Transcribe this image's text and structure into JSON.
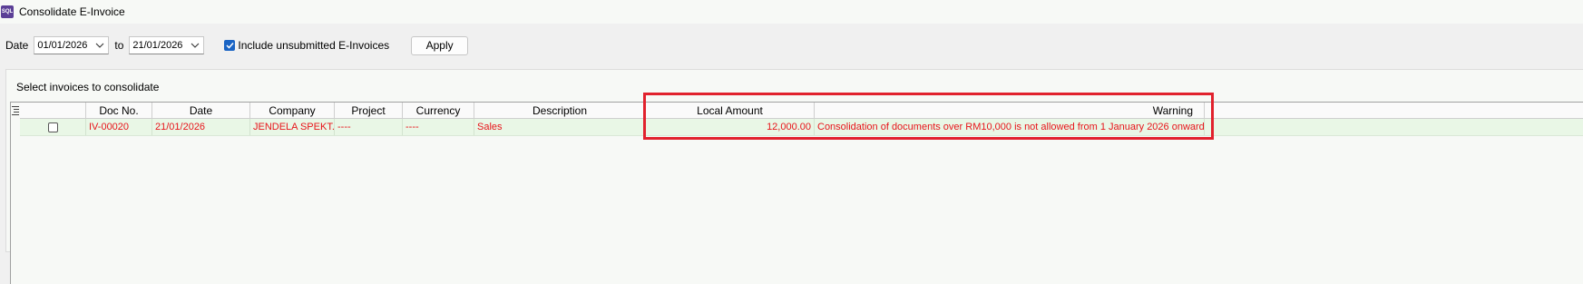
{
  "window": {
    "title": "Consolidate E-Invoice",
    "app_icon_text": "SQL"
  },
  "filters": {
    "date_label": "Date",
    "date_from": "01/01/2026",
    "to_label": "to",
    "date_to": "21/01/2026",
    "include_unsubmitted_label": "Include unsubmitted E-Invoices",
    "include_unsubmitted_checked": true,
    "apply_label": "Apply"
  },
  "panel": {
    "label": "Select invoices to consolidate"
  },
  "grid": {
    "columns": [
      "Doc No.",
      "Date",
      "Company",
      "Project",
      "Currency",
      "Description",
      "Local Amount",
      "Warning"
    ],
    "rows": [
      {
        "selected": false,
        "doc_no": "IV-00020",
        "date": "21/01/2026",
        "company": "JENDELA SPEKT...",
        "project": "----",
        "currency": "----",
        "description": "Sales",
        "local_amount": "12,000.00",
        "warning": "Consolidation of documents over RM10,000 is not allowed from 1 January 2026 onward."
      }
    ]
  },
  "colors": {
    "warning_text": "#e8141a",
    "highlight_border": "#e1222d",
    "row_bg": "#e9f7e6",
    "checkbox_accent": "#1a64c4"
  }
}
